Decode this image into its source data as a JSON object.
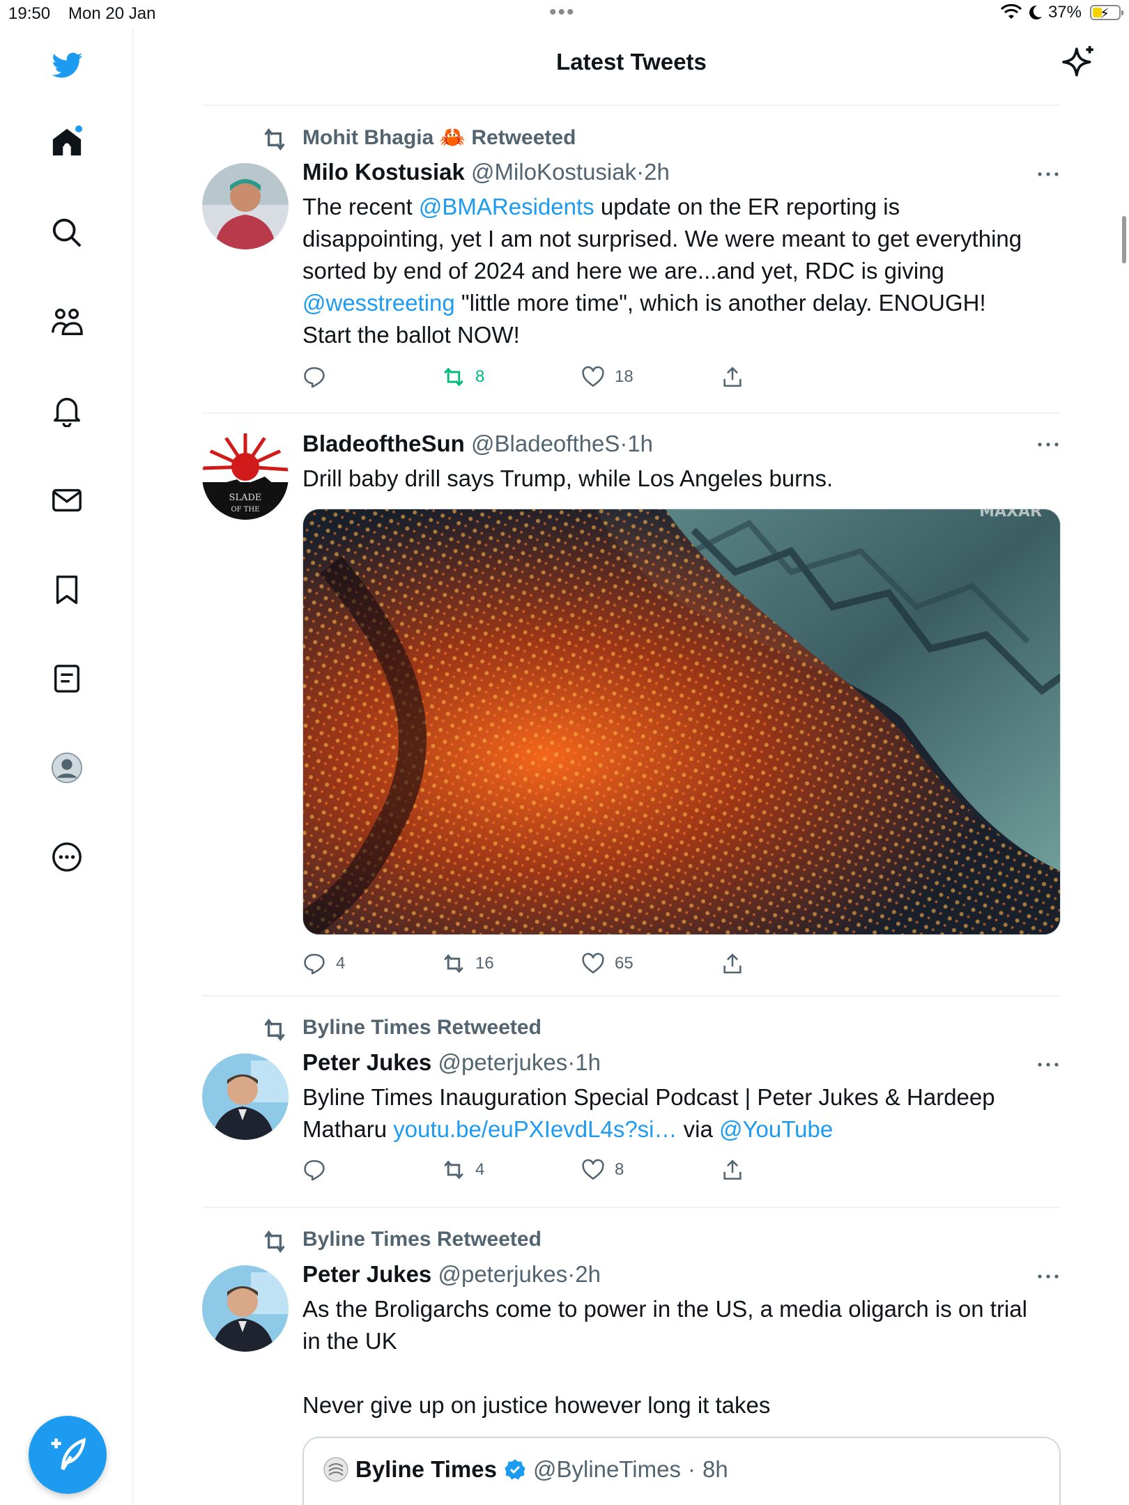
{
  "status_bar": {
    "time": "19:50",
    "date": "Mon 20 Jan",
    "battery": "37%",
    "battery_level": 0.37
  },
  "header": {
    "title": "Latest Tweets"
  },
  "sidebar": {
    "items": [
      {
        "name": "home",
        "icon": "home-icon"
      },
      {
        "name": "explore",
        "icon": "search-icon"
      },
      {
        "name": "communities",
        "icon": "communities-icon"
      },
      {
        "name": "notifications",
        "icon": "bell-icon"
      },
      {
        "name": "messages",
        "icon": "mail-icon"
      },
      {
        "name": "bookmarks",
        "icon": "bookmark-icon"
      },
      {
        "name": "lists",
        "icon": "list-icon"
      },
      {
        "name": "profile",
        "icon": "profile-icon"
      },
      {
        "name": "more",
        "icon": "more-circle-icon"
      }
    ],
    "compose_icon": "compose-icon"
  },
  "tweets": [
    {
      "retweeted_by": "Mohit Bhagia 🦀 Retweeted",
      "name": "Milo Kostusiak",
      "handle": "@MiloKostusiak",
      "sep": "·",
      "time": "2h",
      "text": {
        "l1a": "The recent ",
        "l1link": "@BMAResidents",
        "l1b": " update on the ER reporting is",
        "l2": "disappointing, yet I am not surprised. We were meant to get everything",
        "l3": "sorted by end of 2024 and here we are...and yet, RDC is giving",
        "l4link": "@wesstreeting",
        "l4b": " \"little more time\", which is another delay. ENOUGH!",
        "l5": "Start the ballot NOW!"
      },
      "replies": "",
      "retweets": "8",
      "likes": "18"
    },
    {
      "name": "BladeoftheSun",
      "handle": "@BladeoftheS",
      "sep": "·",
      "time": "1h",
      "text": "Drill baby drill says Trump, while Los Angeles burns.",
      "media_watermark": "MAXAR",
      "replies": "4",
      "retweets": "16",
      "likes": "65"
    },
    {
      "retweeted_by": "Byline Times Retweeted",
      "name": "Peter Jukes",
      "handle": "@peterjukes",
      "sep": "·",
      "time": "1h",
      "text": {
        "l1": "Byline Times Inauguration Special Podcast | Peter Jukes & Hardeep",
        "l2a": "Matharu ",
        "l2link": "youtu.be/euPXIevdL4s?si…",
        "l2b": " via ",
        "l2link2": "@YouTube"
      },
      "replies": "",
      "retweets": "4",
      "likes": "8"
    },
    {
      "retweeted_by": "Byline Times Retweeted",
      "name": "Peter Jukes",
      "handle": "@peterjukes",
      "sep": "·",
      "time": "2h",
      "text": {
        "l1": "As the Broligarchs come to power in the US, a media oligarch is on trial",
        "l2": "in the UK",
        "l3": "Never give up on justice however long it takes"
      },
      "quote": {
        "name": "Byline Times",
        "handle": "@BylineTimes",
        "sep": "·",
        "time": "8h"
      }
    }
  ],
  "colors": {
    "accent": "#1d9bf0",
    "retweet_active": "#00ba7c",
    "muted": "#536471"
  }
}
